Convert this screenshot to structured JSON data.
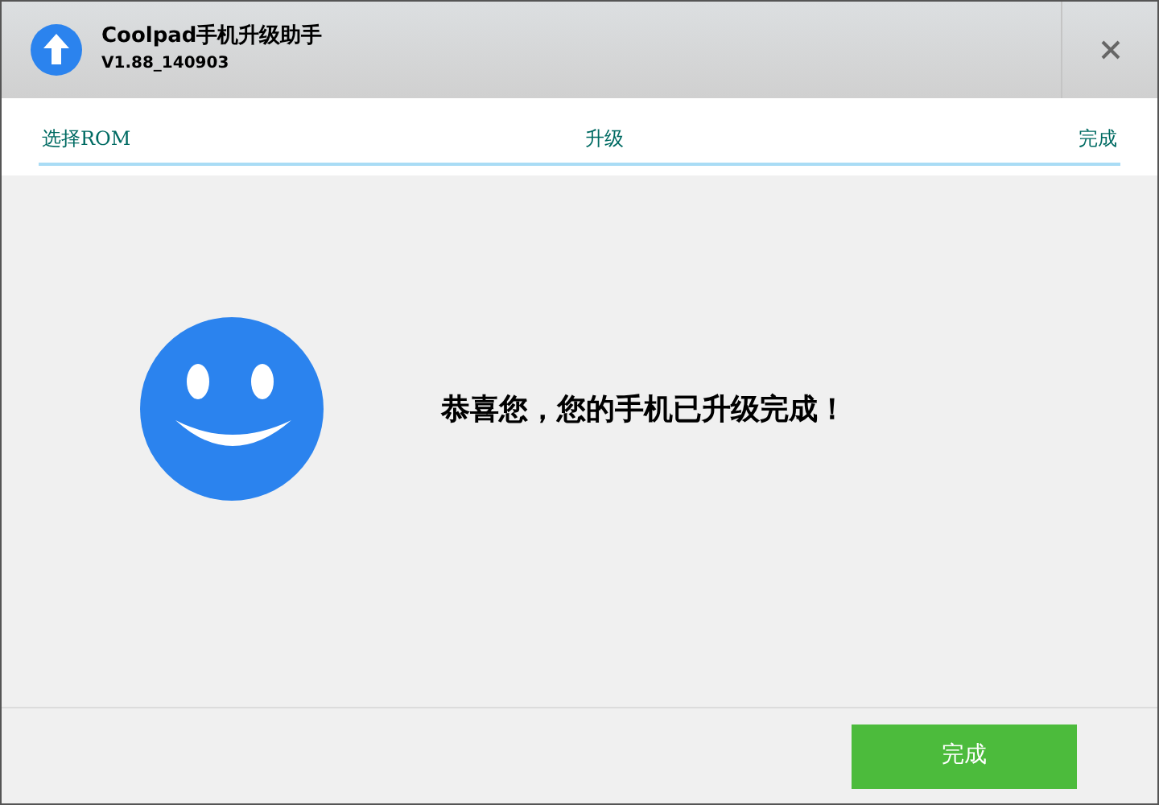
{
  "window": {
    "title": "Coolpad手机升级助手",
    "version": "V1.88_140903"
  },
  "steps": [
    {
      "label": "选择ROM"
    },
    {
      "label": "升级"
    },
    {
      "label": "完成"
    }
  ],
  "message": "恭喜您，您的手机已升级完成！",
  "buttons": [
    "完成"
  ]
}
